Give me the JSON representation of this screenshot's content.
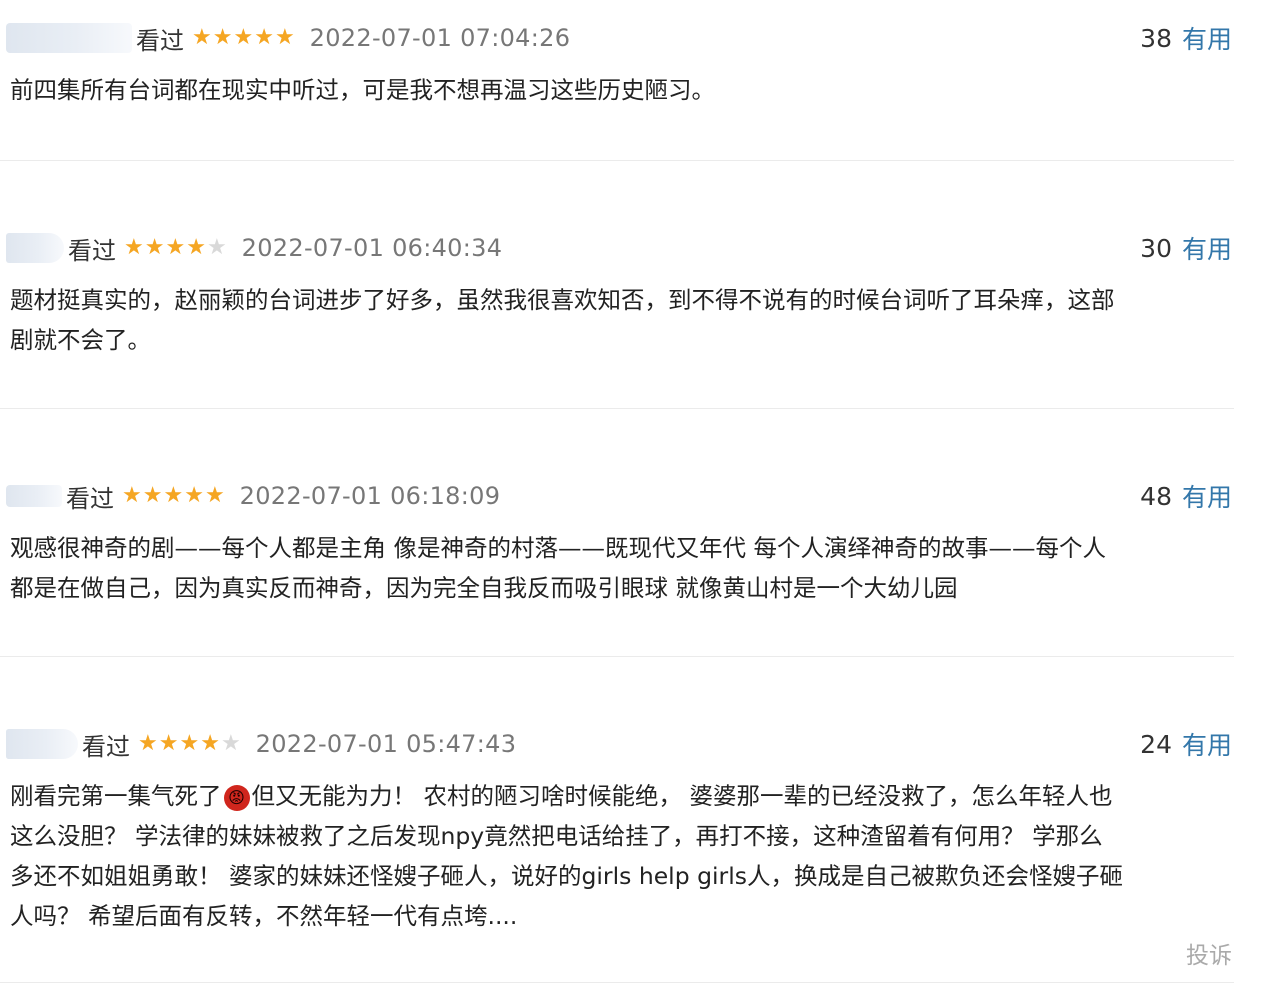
{
  "reviews": [
    {
      "status": "看过",
      "stars": 5,
      "time": "2022-07-01 07:04:26",
      "count": "38",
      "useful": "有用",
      "lines": [
        "前四集所有台词都在现实中听过，可是我不想再温习这些历史陋习。"
      ]
    },
    {
      "status": "看过",
      "stars": 4,
      "time": "2022-07-01 06:40:34",
      "count": "30",
      "useful": "有用",
      "lines": [
        "题材挺真实的，赵丽颖的台词进步了好多，虽然我很喜欢知否，到不得不说有的时候台词听了耳朵痒，这部",
        "剧就不会了。"
      ]
    },
    {
      "status": "看过",
      "stars": 5,
      "time": "2022-07-01 06:18:09",
      "count": "48",
      "useful": "有用",
      "lines": [
        "观感很神奇的剧——每个人都是主角 像是神奇的村落——既现代又年代 每个人演绎神奇的故事——每个人",
        "都是在做自己，因为真实反而神奇，因为完全自我反而吸引眼球 就像黄山村是一个大幼儿园"
      ]
    },
    {
      "status": "看过",
      "stars": 4,
      "time": "2022-07-01 05:47:43",
      "count": "24",
      "useful": "有用",
      "line1_a": "刚看完第一集气死了",
      "emoji": "😡",
      "line1_b": "但又无能为力！ 农村的陋习啥时候能绝， 婆婆那一辈的已经没救了，怎么年轻人也",
      "lines": [
        "这么没胆？ 学法律的妹妹被救了之后发现npy竟然把电话给挂了，再打不接，这种渣留着有何用？ 学那么",
        "多还不如姐姐勇敢！ 婆家的妹妹还怪嫂子砸人，说好的girls help girls人，换成是自己被欺负还会怪嫂子砸",
        "人吗？ 希望后面有反转，不然年轻一代有点垮...."
      ]
    }
  ],
  "report": "投诉",
  "colors": {
    "star": "#f5a623",
    "useful": "#3377aa"
  }
}
